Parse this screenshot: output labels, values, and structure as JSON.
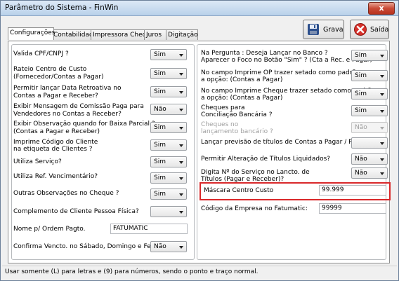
{
  "window": {
    "title": "Parâmetro do Sistema - FinWin",
    "close_symbol": "x"
  },
  "toolbar": {
    "save_label": "Grava",
    "exit_label": "Saída"
  },
  "tabs": [
    {
      "label": "Configurações",
      "active": true
    },
    {
      "label": "Contabilidade",
      "active": false
    },
    {
      "label": "Impressora Cheque",
      "active": false
    },
    {
      "label": "Juros",
      "active": false
    },
    {
      "label": "Digitação",
      "active": false
    }
  ],
  "left": {
    "valida_cpf": {
      "label": "Valida CPF/CNPJ ?",
      "value": "Sim"
    },
    "rateio": {
      "label1": "Rateio Centro de Custo",
      "label2": "(Fornecedor/Contas a Pagar)",
      "value": "Sim"
    },
    "data_retroativa": {
      "label1": "Permitir lançar Data Retroativa no",
      "label2": "Contas a Pagar e Receber?",
      "value": "Sim"
    },
    "msg_comissao": {
      "label1": "Exibir Mensagem de Comissão Paga para",
      "label2": "Vendedores no Contas a Receber?",
      "value": "Não"
    },
    "outro_quando": {
      "label1": "Exibir Observação quando for Baixa Parcial ?",
      "label2": "(Contas a Pagar e Receber)",
      "value": "Sim"
    },
    "codigo_cliente": {
      "label1": "Imprime Código do Cliente",
      "label2": "na etiqueta de Clientes ?",
      "value": "Sim"
    },
    "utiliza_servico": {
      "label": "Utiliza Serviço?",
      "value": "Sim"
    },
    "vencimentario": {
      "label": "Utiliza Ref. Vencimentário?",
      "value": "Sim"
    },
    "obs_cheque": {
      "label": "Outras Observações no Cheque ?",
      "value": "Sim"
    },
    "complemento": {
      "label": "Complemento de Cliente Pessoa Física?",
      "value": ""
    },
    "nome_ordem": {
      "label": "Nome p/ Ordem Pagto.",
      "value": "FATUMATIC"
    },
    "confirma_vencto": {
      "label": "Confirma Vencto. no Sábado, Domingo e Feriados ?",
      "value": "Não"
    }
  },
  "right": {
    "pergunta": {
      "label1": "Na Pergunta : Deseja Lançar  no Banco ?",
      "label2": "Aparecer  o Foco no Botão \"Sim\" ? (Cta a Rec. e Pagar)",
      "value": "Sim"
    },
    "imprime_op": {
      "label1": "No campo Imprime OP trazer setado como padrão",
      "label2": "a opção: (Contas a Pagar)",
      "value": "Sim"
    },
    "imprime_cheque": {
      "label1": "No campo Imprime Cheque trazer setado como padrão",
      "label2": "a opção: (Contas a Pagar)",
      "value": "Sim"
    },
    "cheques_conciliacao": {
      "label1": "Cheques para",
      "label2": "Conciliação Bancária ?",
      "value": "Sim"
    },
    "cheques_lancamento": {
      "label1": "Cheques no",
      "label2": "lançamento bancário ?",
      "value": "Não"
    },
    "previsao_titulos": {
      "label": "Lançar previsão de títulos de Contas a Pagar / Receber?",
      "value": ""
    },
    "alteracao_titulos": {
      "label": "Permitir Alteração de Títulos Liquidados?",
      "value": "Não"
    },
    "digita_servico": {
      "label1": "Digita Nº do Serviço no Lancto. de",
      "label2": "Títulos (Pagar e Receber)?",
      "value": "Não"
    },
    "mascara_cc": {
      "label": "Máscara Centro Custo",
      "value": "99.999"
    },
    "codigo_empresa": {
      "label": "Código da Empresa no Fatumatic:",
      "value": "99999"
    }
  },
  "status": {
    "text": "Usar somente (L) para letras e (9) para números, sendo o ponto e traço normal."
  },
  "colors": {
    "highlight": "#d9282a",
    "close_button": "#c94a36"
  }
}
